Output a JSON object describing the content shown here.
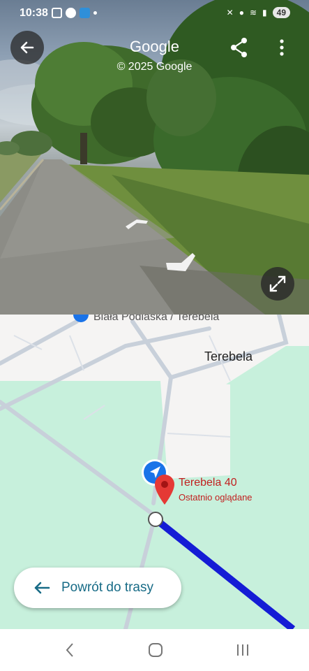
{
  "status": {
    "time": "10:38",
    "battery": "49"
  },
  "streetview": {
    "title": "Google",
    "copyright": "© 2025 Google"
  },
  "map": {
    "route_label": "Biała Podlaska / Terebela",
    "town_label": "Terebela",
    "place_name": "Terebela 40",
    "place_subtitle": "Ostatnio oglądane"
  },
  "return_button": {
    "label": "Powrót do trasy"
  },
  "colors": {
    "accent": "#176b86",
    "route": "#1a21e8",
    "pin": "#e53935",
    "map_bg": "#c7f0dc"
  },
  "icons": [
    "back-arrow-icon",
    "share-icon",
    "more-vert-icon",
    "expand-icon",
    "navigation-arrow-icon",
    "location-pin-icon",
    "nav-back-icon",
    "nav-home-icon",
    "nav-recents-icon"
  ]
}
